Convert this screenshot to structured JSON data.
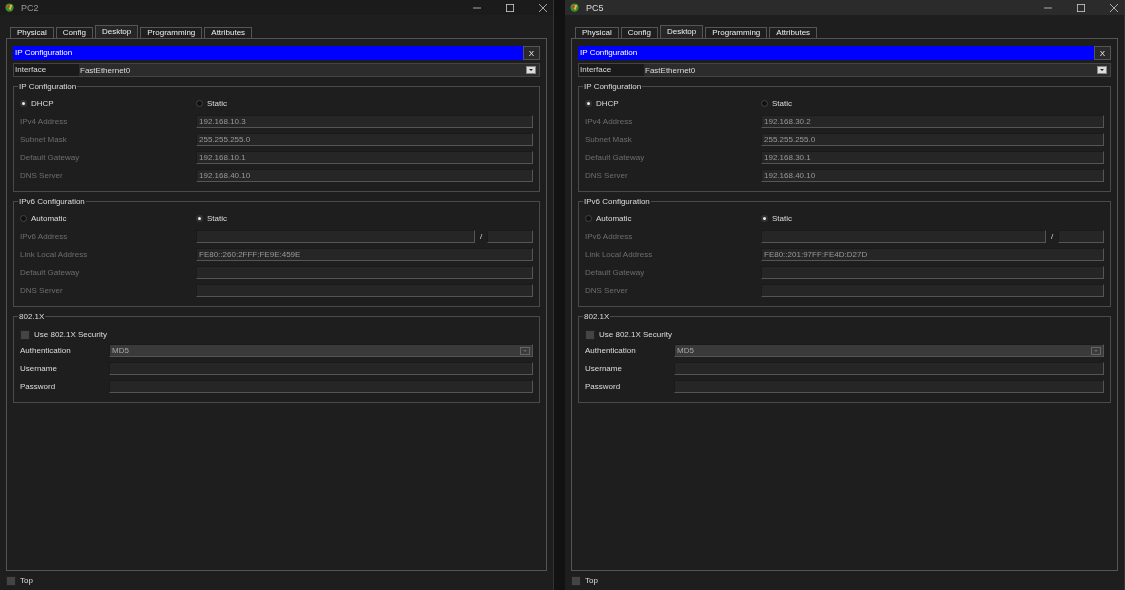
{
  "windows": [
    {
      "title": "PC2",
      "active": false,
      "controls": [
        {
          "kind": "minimize"
        },
        {
          "kind": "maximize"
        },
        {
          "kind": "close"
        }
      ],
      "tabs": [
        {
          "label": "Physical",
          "selected": false
        },
        {
          "label": "Config",
          "selected": false
        },
        {
          "label": "Desktop",
          "selected": true
        },
        {
          "label": "Programming",
          "selected": false
        },
        {
          "label": "Attributes",
          "selected": false
        }
      ],
      "panel_title": "IP Configuration",
      "close_label": "X",
      "interface": {
        "label": "Interface",
        "value": "FastEthernet0"
      },
      "groups": [
        {
          "kind": "ip",
          "legend": "IP Configuration",
          "options": [
            {
              "label": "DHCP",
              "selected": true
            },
            {
              "label": "Static",
              "selected": false
            }
          ],
          "fields": [
            {
              "kind": "text",
              "label": "IPv4 Address",
              "value": "192.168.10.3",
              "disabled": true
            },
            {
              "kind": "text",
              "label": "Subnet Mask",
              "value": "255.255.255.0",
              "disabled": true
            },
            {
              "kind": "text",
              "label": "Default Gateway",
              "value": "192.168.10.1",
              "disabled": true
            },
            {
              "kind": "text",
              "label": "DNS Server",
              "value": "192.168.40.10",
              "disabled": true
            }
          ]
        },
        {
          "kind": "ip",
          "legend": "IPv6 Configuration",
          "options": [
            {
              "label": "Automatic",
              "selected": false
            },
            {
              "label": "Static",
              "selected": true
            }
          ],
          "fields": [
            {
              "kind": "prefix",
              "label": "IPv6 Address",
              "separator": "/",
              "disabled": true
            },
            {
              "kind": "text",
              "label": "Link Local Address",
              "value": "FE80::260:2FFF:FE9E:459E",
              "disabled": true
            },
            {
              "kind": "text",
              "label": "Default Gateway",
              "disabled": true
            },
            {
              "kind": "text",
              "label": "DNS Server",
              "disabled": true
            }
          ]
        },
        {
          "kind": "security",
          "legend": "802.1X",
          "checkbox": {
            "label": "Use 802.1X Security",
            "checked": false
          },
          "fields": [
            {
              "kind": "dropdown",
              "label": "Authentication",
              "value": "MD5",
              "disabled": false
            },
            {
              "kind": "text",
              "label": "Username",
              "disabled": false
            },
            {
              "kind": "text",
              "label": "Password",
              "disabled": false
            }
          ]
        }
      ],
      "top": {
        "label": "Top",
        "checked": false
      }
    },
    {
      "title": "PC5",
      "active": true,
      "controls": [
        {
          "kind": "minimize"
        },
        {
          "kind": "maximize"
        },
        {
          "kind": "close"
        }
      ],
      "tabs": [
        {
          "label": "Physical",
          "selected": false
        },
        {
          "label": "Config",
          "selected": false
        },
        {
          "label": "Desktop",
          "selected": true
        },
        {
          "label": "Programming",
          "selected": false
        },
        {
          "label": "Attributes",
          "selected": false
        }
      ],
      "panel_title": "IP Configuration",
      "close_label": "X",
      "interface": {
        "label": "Interface",
        "value": "FastEthernet0"
      },
      "groups": [
        {
          "kind": "ip",
          "legend": "IP Configuration",
          "options": [
            {
              "label": "DHCP",
              "selected": true
            },
            {
              "label": "Static",
              "selected": false
            }
          ],
          "fields": [
            {
              "kind": "text",
              "label": "IPv4 Address",
              "value": "192.168.30.2",
              "disabled": true
            },
            {
              "kind": "text",
              "label": "Subnet Mask",
              "value": "255.255.255.0",
              "disabled": true
            },
            {
              "kind": "text",
              "label": "Default Gateway",
              "value": "192.168.30.1",
              "disabled": true
            },
            {
              "kind": "text",
              "label": "DNS Server",
              "value": "192.168.40.10",
              "disabled": true
            }
          ]
        },
        {
          "kind": "ip",
          "legend": "IPv6 Configuration",
          "options": [
            {
              "label": "Automatic",
              "selected": false
            },
            {
              "label": "Static",
              "selected": true
            }
          ],
          "fields": [
            {
              "kind": "prefix",
              "label": "IPv6 Address",
              "separator": "/",
              "disabled": true
            },
            {
              "kind": "text",
              "label": "Link Local Address",
              "value": "FE80::201:97FF:FE4D:D27D",
              "disabled": true
            },
            {
              "kind": "text",
              "label": "Default Gateway",
              "disabled": true
            },
            {
              "kind": "text",
              "label": "DNS Server",
              "disabled": true
            }
          ]
        },
        {
          "kind": "security",
          "legend": "802.1X",
          "checkbox": {
            "label": "Use 802.1X Security",
            "checked": false
          },
          "fields": [
            {
              "kind": "dropdown",
              "label": "Authentication",
              "value": "MD5",
              "disabled": false
            },
            {
              "kind": "text",
              "label": "Username",
              "disabled": false
            },
            {
              "kind": "text",
              "label": "Password",
              "disabled": false
            }
          ]
        }
      ],
      "top": {
        "label": "Top",
        "checked": false
      }
    }
  ]
}
